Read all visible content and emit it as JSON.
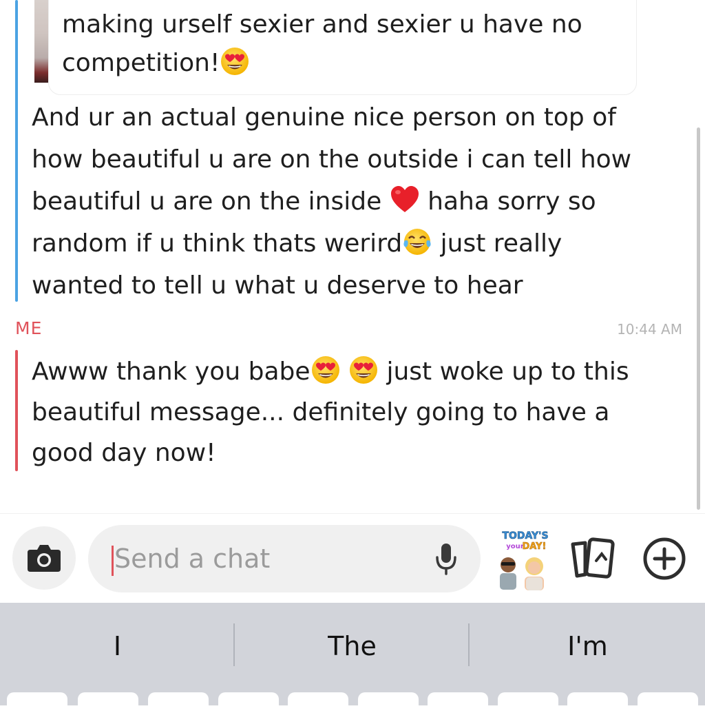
{
  "conversation": {
    "quoted_message": "making urself sexier and sexier u have no competition!",
    "incoming_message": {
      "line1": "And ur an actual genuine nice person on top of",
      "line2": "how beautiful u are on the outside i can tell how",
      "line3a": "beautiful u are on the inside",
      "line3b": "haha sorry so",
      "line4a": "random if u think thats werird",
      "line4b": "just  really",
      "line5": "wanted to tell u what u deserve to hear"
    },
    "outgoing_sender": "ME",
    "outgoing_time": "10:44 AM",
    "outgoing_message": {
      "line1a": "Awww thank you babe",
      "line1b": "just woke up to this",
      "line2": "beautiful message... definitely going to have a",
      "line3": "good day now!"
    }
  },
  "compose": {
    "placeholder": "Send a chat",
    "sticker_text_top": "TODAY'S",
    "sticker_text_mid": "your",
    "sticker_text_bottom": "DAY!"
  },
  "keyboard": {
    "suggestions": [
      "I",
      "The",
      "I'm"
    ]
  },
  "colors": {
    "accent_red": "#e0525a",
    "accent_blue": "#4ba3e3",
    "keyboard_bg": "#d2d4da"
  },
  "icons": {
    "camera": "camera-icon",
    "mic": "microphone-icon",
    "cards": "cards-icon",
    "plus": "plus-circle-icon",
    "emoji_heart_eyes": "heart-eyes-emoji-icon",
    "emoji_heart": "red-heart-emoji-icon",
    "emoji_laugh": "tears-of-joy-emoji-icon"
  }
}
